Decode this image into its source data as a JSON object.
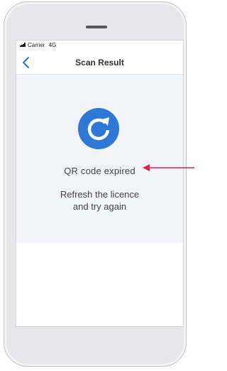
{
  "status_bar": {
    "carrier": "Carrier",
    "network": "4G"
  },
  "nav": {
    "title": "Scan Result",
    "back_icon": "chevron-left-icon"
  },
  "result": {
    "icon": "refresh-icon",
    "title": "QR code expired",
    "message_line1": "Refresh the licence",
    "message_line2": "and try again"
  },
  "colors": {
    "accent": "#2c78d6",
    "panel_background": "#f2f4f8",
    "annotation": "#e0204a"
  }
}
